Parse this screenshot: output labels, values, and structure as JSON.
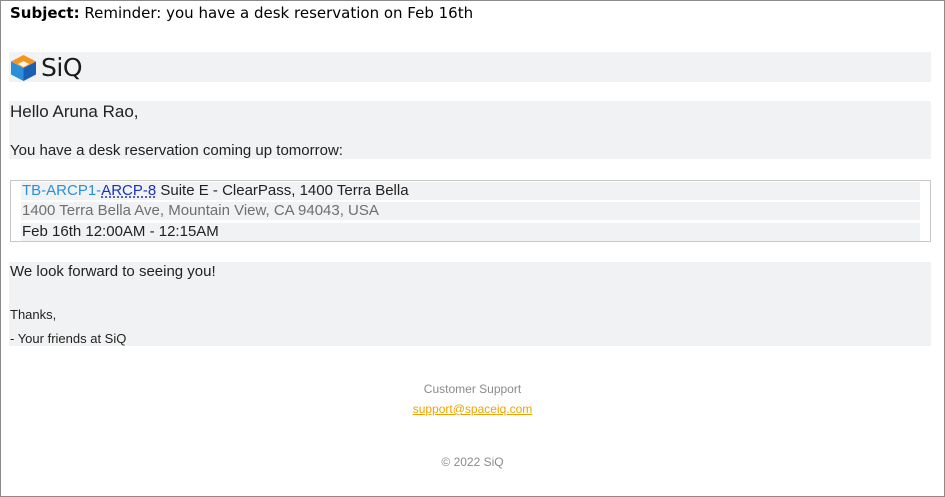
{
  "email": {
    "subject_label": "Subject:",
    "subject": "Reminder: you have a desk reservation on Feb 16th"
  },
  "brand": {
    "name": "SiQ",
    "colors": {
      "orange": "#f7941d",
      "blue": "#2a8fd8",
      "dark_blue": "#1a5fb4"
    }
  },
  "body": {
    "greeting": "Hello Aruna Rao,",
    "intro": "You have a desk reservation coming up tomorrow:"
  },
  "reservation": {
    "desk_prefix": "TB-ARCP1-",
    "desk_link": "ARCP-8",
    "desk_location": " Suite E - ClearPass, 1400 Terra Bella",
    "address": "1400 Terra Bella Ave, Mountain View, CA 94043, USA",
    "time": "Feb 16th 12:00AM - 12:15AM"
  },
  "closing": {
    "look_forward": "We look forward to seeing you!",
    "thanks": "Thanks,",
    "signature": "- Your friends at SiQ"
  },
  "footer": {
    "support_label": "Customer Support",
    "support_email": "support@spaceiq.com",
    "copyright": "© 2022 SiQ"
  }
}
